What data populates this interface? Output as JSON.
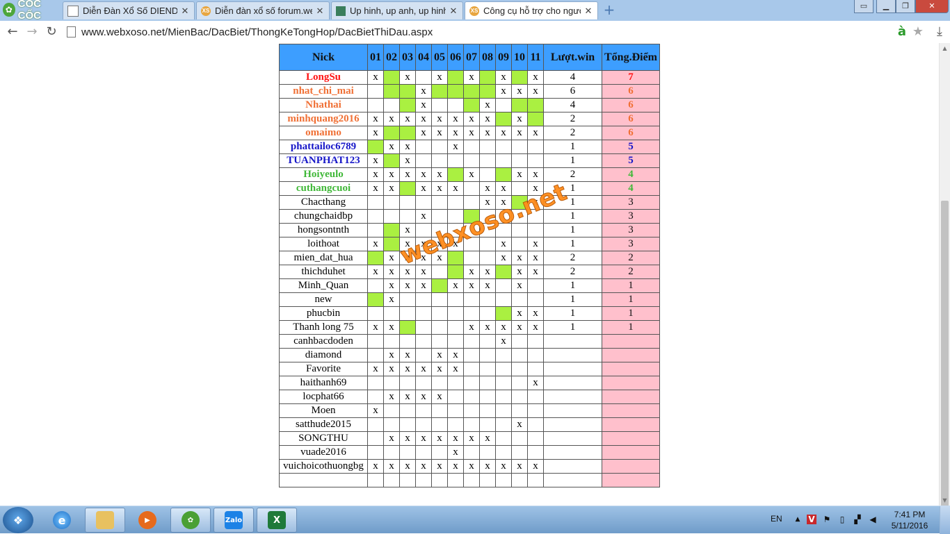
{
  "browser": {
    "logo": "CỐC CỐC",
    "tabs": [
      {
        "title": "Diễn Đàn Xổ Số DIENDAN",
        "favicon": "page-icon",
        "active": false
      },
      {
        "title": "Diễn đàn xổ số forum.web",
        "favicon": "xs-icon",
        "active": false
      },
      {
        "title": "Up hinh, up anh, up hinh r",
        "favicon": "image-icon",
        "active": false
      },
      {
        "title": "Công cụ hỗ trợ cho người",
        "favicon": "xs-icon",
        "active": true
      }
    ],
    "url": "www.webxoso.net/MienBac/DacBiet/ThongKeTongHop/DacBietThiDau.aspx"
  },
  "table": {
    "headers": [
      "Nick",
      "01",
      "02",
      "03",
      "04",
      "05",
      "06",
      "07",
      "08",
      "09",
      "10",
      "11",
      "Lượt.win",
      "Tổng.Điểm"
    ],
    "rows": [
      {
        "nick": "LongSu",
        "color": "red",
        "cells": [
          "x",
          "g",
          "x",
          "",
          "x",
          "g",
          "x",
          "g",
          "x",
          "g",
          "x"
        ],
        "wins": "4",
        "points": "7"
      },
      {
        "nick": "nhat_chi_mai",
        "color": "orange",
        "cells": [
          "",
          "g",
          "g",
          "x",
          "g",
          "g",
          "g",
          "g",
          "x",
          "x",
          "x"
        ],
        "wins": "6",
        "points": "6"
      },
      {
        "nick": "Nhathai",
        "color": "orange",
        "cells": [
          "",
          "",
          "g",
          "x",
          "",
          "",
          "g",
          "x",
          "",
          "g",
          "g"
        ],
        "wins": "4",
        "points": "6"
      },
      {
        "nick": "minhquang2016",
        "color": "orange",
        "cells": [
          "x",
          "x",
          "x",
          "x",
          "x",
          "x",
          "x",
          "x",
          "g",
          "x",
          "g"
        ],
        "wins": "2",
        "points": "6"
      },
      {
        "nick": "omaimo",
        "color": "orange",
        "cells": [
          "x",
          "g",
          "g",
          "x",
          "x",
          "x",
          "x",
          "x",
          "x",
          "x",
          "x"
        ],
        "wins": "2",
        "points": "6"
      },
      {
        "nick": "phattailoc6789",
        "color": "blue",
        "cells": [
          "g",
          "x",
          "x",
          "",
          "",
          "x",
          "",
          "",
          "",
          "",
          ""
        ],
        "wins": "1",
        "points": "5"
      },
      {
        "nick": "TUANPHAT123",
        "color": "blue",
        "cells": [
          "x",
          "g",
          "x",
          "",
          "",
          "",
          "",
          "",
          "",
          "",
          ""
        ],
        "wins": "1",
        "points": "5"
      },
      {
        "nick": "Hoiyeulo",
        "color": "green",
        "cells": [
          "x",
          "x",
          "x",
          "x",
          "x",
          "g",
          "x",
          "",
          "g",
          "x",
          "x"
        ],
        "wins": "2",
        "points": "4"
      },
      {
        "nick": "cuthangcuoi",
        "color": "green",
        "cells": [
          "x",
          "x",
          "g",
          "x",
          "x",
          "x",
          "",
          "x",
          "x",
          "",
          "x"
        ],
        "wins": "1",
        "points": "4"
      },
      {
        "nick": "Chacthang",
        "color": "plain",
        "cells": [
          "",
          "",
          "",
          "",
          "",
          "",
          "",
          "x",
          "x",
          "g",
          "x"
        ],
        "wins": "1",
        "points": "3"
      },
      {
        "nick": "chungchaidbp",
        "color": "plain",
        "cells": [
          "",
          "",
          "",
          "x",
          "",
          "",
          "g",
          "",
          "",
          "",
          ""
        ],
        "wins": "1",
        "points": "3"
      },
      {
        "nick": "hongsontnth",
        "color": "plain",
        "cells": [
          "",
          "g",
          "x",
          "",
          "",
          "",
          "",
          "",
          "",
          "",
          ""
        ],
        "wins": "1",
        "points": "3"
      },
      {
        "nick": "loithoat",
        "color": "plain",
        "cells": [
          "x",
          "g",
          "x",
          "x",
          "x",
          "x",
          "",
          "",
          "x",
          "",
          "x"
        ],
        "wins": "1",
        "points": "3"
      },
      {
        "nick": "mien_dat_hua",
        "color": "plain",
        "cells": [
          "g",
          "x",
          "x",
          "x",
          "x",
          "g",
          "",
          "",
          "x",
          "x",
          "x"
        ],
        "wins": "2",
        "points": "2"
      },
      {
        "nick": "thichduhet",
        "color": "plain",
        "cells": [
          "x",
          "x",
          "x",
          "x",
          "",
          "g",
          "x",
          "x",
          "g",
          "x",
          "x"
        ],
        "wins": "2",
        "points": "2"
      },
      {
        "nick": "Minh_Quan",
        "color": "plain",
        "cells": [
          "",
          "x",
          "x",
          "x",
          "g",
          "x",
          "x",
          "x",
          "",
          "x",
          ""
        ],
        "wins": "1",
        "points": "1"
      },
      {
        "nick": "new",
        "color": "plain",
        "cells": [
          "g",
          "x",
          "",
          "",
          "",
          "",
          "",
          "",
          "",
          "",
          ""
        ],
        "wins": "1",
        "points": "1"
      },
      {
        "nick": "phucbin",
        "color": "plain",
        "cells": [
          "",
          "",
          "",
          "",
          "",
          "",
          "",
          "",
          "g",
          "x",
          "x"
        ],
        "wins": "1",
        "points": "1"
      },
      {
        "nick": "Thanh long 75",
        "color": "plain",
        "cells": [
          "x",
          "x",
          "g",
          "",
          "",
          "",
          "x",
          "x",
          "x",
          "x",
          "x"
        ],
        "wins": "1",
        "points": "1"
      },
      {
        "nick": "canhbacdoden",
        "color": "plain",
        "cells": [
          "",
          "",
          "",
          "",
          "",
          "",
          "",
          "",
          "x",
          "",
          ""
        ],
        "wins": "",
        "points": ""
      },
      {
        "nick": "diamond",
        "color": "plain",
        "cells": [
          "",
          "x",
          "x",
          "",
          "x",
          "x",
          "",
          "",
          "",
          "",
          ""
        ],
        "wins": "",
        "points": ""
      },
      {
        "nick": "Favorite",
        "color": "plain",
        "cells": [
          "x",
          "x",
          "x",
          "x",
          "x",
          "x",
          "",
          "",
          "",
          "",
          ""
        ],
        "wins": "",
        "points": ""
      },
      {
        "nick": "haithanh69",
        "color": "plain",
        "cells": [
          "",
          "",
          "",
          "",
          "",
          "",
          "",
          "",
          "",
          "",
          "x"
        ],
        "wins": "",
        "points": ""
      },
      {
        "nick": "locphat66",
        "color": "plain",
        "cells": [
          "",
          "x",
          "x",
          "x",
          "x",
          "",
          "",
          "",
          "",
          "",
          ""
        ],
        "wins": "",
        "points": ""
      },
      {
        "nick": "Moen",
        "color": "plain",
        "cells": [
          "x",
          "",
          "",
          "",
          "",
          "",
          "",
          "",
          "",
          "",
          ""
        ],
        "wins": "",
        "points": ""
      },
      {
        "nick": "satthude2015",
        "color": "plain",
        "cells": [
          "",
          "",
          "",
          "",
          "",
          "",
          "",
          "",
          "",
          "x",
          ""
        ],
        "wins": "",
        "points": ""
      },
      {
        "nick": "SONGTHU",
        "color": "plain",
        "cells": [
          "",
          "x",
          "x",
          "x",
          "x",
          "x",
          "x",
          "x",
          "",
          "",
          ""
        ],
        "wins": "",
        "points": ""
      },
      {
        "nick": "vuade2016",
        "color": "plain",
        "cells": [
          "",
          "",
          "",
          "",
          "",
          "x",
          "",
          "",
          "",
          "",
          ""
        ],
        "wins": "",
        "points": ""
      },
      {
        "nick": "vuichoicothuongbg",
        "color": "plain",
        "cells": [
          "x",
          "x",
          "x",
          "x",
          "x",
          "x",
          "x",
          "x",
          "x",
          "x",
          "x"
        ],
        "wins": "",
        "points": ""
      },
      {
        "nick": "",
        "color": "plain",
        "cells": [
          "",
          "",
          "",
          "",
          "",
          "",
          "",
          "",
          "",
          "",
          ""
        ],
        "wins": "",
        "points": ""
      }
    ]
  },
  "watermark": "webxoso.net",
  "taskbar": {
    "apps": [
      "windows-explorer-icon",
      "internet-explorer-icon",
      "file-manager-icon",
      "media-player-icon",
      "coccoc-browser-icon",
      "zalo-icon",
      "excel-icon"
    ],
    "zalo_label": "Zalo",
    "language": "EN",
    "time": "7:41 PM",
    "date": "5/11/2016"
  },
  "colors": {
    "header_bg": "#3d9eff",
    "green_cell": "#aaf041",
    "points_bg": "#ffc0cc",
    "red_nick": "#ff1111",
    "orange_nick": "#f07035",
    "blue_nick": "#1616c8",
    "green_nick": "#40b838"
  }
}
